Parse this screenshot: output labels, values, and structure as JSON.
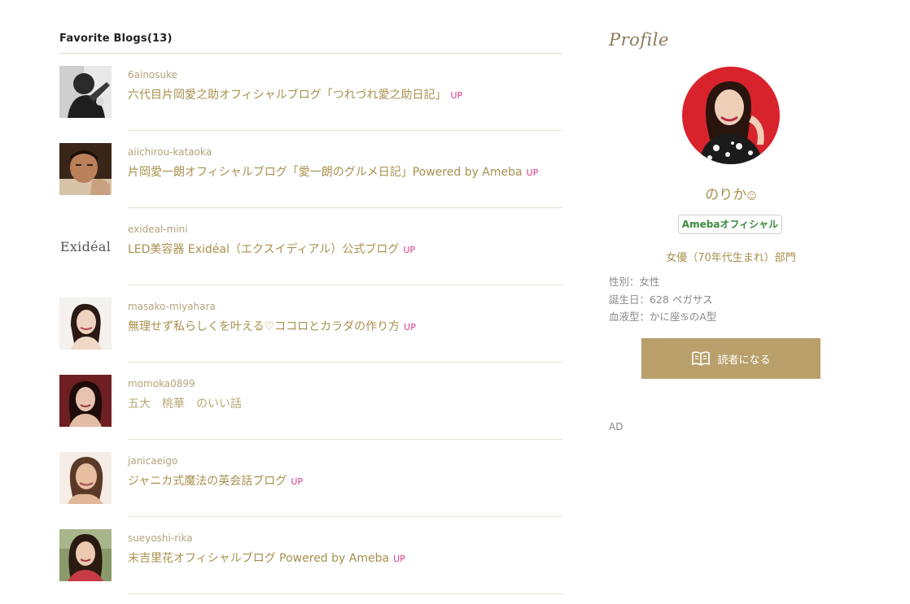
{
  "favorites": {
    "title": "Favorite Blogs(13)",
    "items": [
      {
        "id": "6ainosuke",
        "name": "六代目片岡愛之助オフィシャルブログ「つれづれ愛之助日記」",
        "badge": "UP"
      },
      {
        "id": "aiichirou-kataoka",
        "name": "片岡愛一朗オフィシャルブログ「愛一朗のグルメ日記」Powered by Ameba",
        "badge": "UP"
      },
      {
        "id": "exideal-mini",
        "name": "LED美容器 Exidéal（エクスイディアル）公式ブログ",
        "badge": "UP",
        "logo_text": "Exidéal"
      },
      {
        "id": "masako-miyahara",
        "name": "無理せず私らしくを叶える♡ココロとカラダの作り方",
        "badge": "UP"
      },
      {
        "id": "momoka0899",
        "name": "五大　桃華　のいい話",
        "badge": ""
      },
      {
        "id": "janicaeigo",
        "name": "ジャニカ式魔法の英会話ブログ",
        "badge": "UP"
      },
      {
        "id": "sueyoshi-rika",
        "name": "末吉里花オフィシャルブログ Powered by Ameba",
        "badge": "UP"
      }
    ]
  },
  "profile": {
    "heading": "Profile",
    "name": "のりか",
    "name_emoji": "☺",
    "official_badge": "Amebaオフィシャル",
    "category": "女優（70年代生まれ）部門",
    "gender": "性別：女性",
    "birthday": "誕生日：628 ペガサス",
    "blood_type": "血液型：かに座♋のA型",
    "follow_label": "読者になる",
    "ad_label": "AD"
  },
  "colors": {
    "accent": "#a7904e",
    "button": "#b99f6a",
    "up_badge": "#d43d88",
    "official_green": "#3c8a3c"
  }
}
